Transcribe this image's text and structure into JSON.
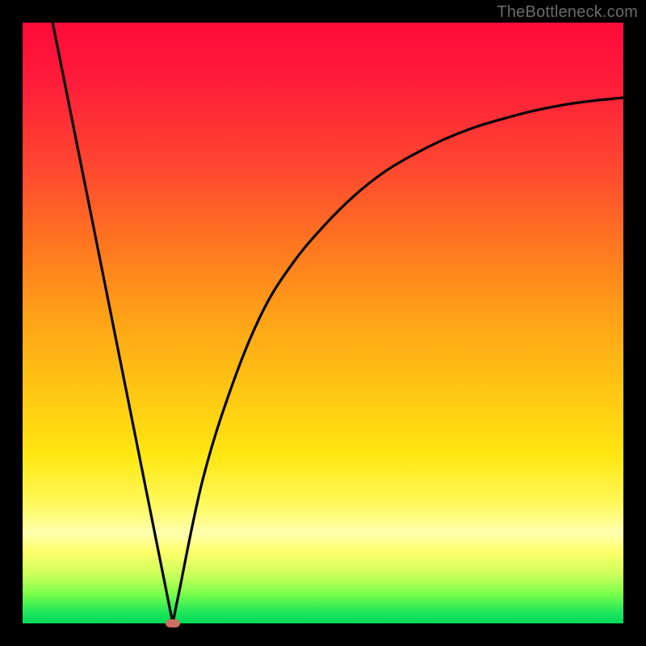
{
  "watermark": "TheBottleneck.com",
  "chart_data": {
    "type": "line",
    "title": "",
    "xlabel": "",
    "ylabel": "",
    "xlim": [
      0,
      100
    ],
    "ylim": [
      0,
      100
    ],
    "grid": false,
    "series": [
      {
        "name": "bottleneck-curve",
        "x": [
          5,
          10,
          15,
          20,
          24,
          25,
          26,
          30,
          35,
          40,
          45,
          50,
          55,
          60,
          65,
          70,
          75,
          80,
          85,
          90,
          95,
          100
        ],
        "y": [
          100,
          75,
          50,
          25,
          5,
          0,
          5,
          24,
          40,
          52,
          60,
          66,
          71,
          75,
          78,
          80.5,
          82.5,
          84,
          85.3,
          86.3,
          87,
          87.5
        ]
      }
    ],
    "marker": {
      "x": 25,
      "y": 0
    },
    "gradient_stops": [
      {
        "pct": 0,
        "color": "#ff0a3a"
      },
      {
        "pct": 50,
        "color": "#ffa516"
      },
      {
        "pct": 80,
        "color": "#fff95a"
      },
      {
        "pct": 100,
        "color": "#00d95a"
      }
    ]
  }
}
